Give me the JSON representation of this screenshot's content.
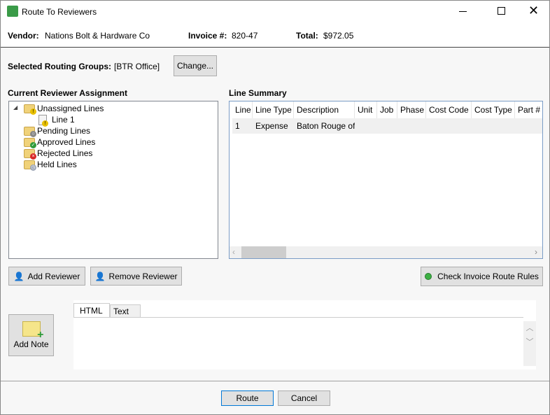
{
  "window": {
    "title": "Route To Reviewers",
    "controls": [
      "minimize",
      "maximize",
      "close"
    ]
  },
  "header": {
    "vendor_label": "Vendor:",
    "vendor": "Nations Bolt & Hardware Co",
    "invoice_label": "Invoice #:",
    "invoice": "820-47",
    "total_label": "Total:",
    "total": "$972.05"
  },
  "routing": {
    "label": "Selected Routing Groups:",
    "value": "[BTR Office]",
    "change_button": "Change..."
  },
  "tree": {
    "title": "Current Reviewer Assignment",
    "items": [
      {
        "label": "Unassigned Lines",
        "icon": "folder-warning-icon"
      },
      {
        "label": "Line 1",
        "icon": "document-warning-icon"
      },
      {
        "label": "Pending Lines",
        "icon": "folder-search-icon"
      },
      {
        "label": "Approved Lines",
        "icon": "folder-check-icon"
      },
      {
        "label": "Rejected Lines",
        "icon": "folder-reject-icon"
      },
      {
        "label": "Held Lines",
        "icon": "folder-clock-icon"
      }
    ]
  },
  "grid": {
    "title": "Line Summary",
    "columns": [
      "Line",
      "Line Type",
      "Description",
      "Unit",
      "Job",
      "Phase",
      "Cost Code",
      "Cost Type",
      "Part #"
    ],
    "rows": [
      [
        "1",
        "Expense",
        "Baton Rouge of",
        "",
        "",
        "",
        "",
        "",
        ""
      ]
    ]
  },
  "buttons": {
    "add_reviewer": "Add Reviewer",
    "remove_reviewer": "Remove Reviewer",
    "check_rules": "Check Invoice Route Rules",
    "add_note": "Add Note",
    "route": "Route",
    "cancel": "Cancel"
  },
  "note_tabs": [
    "HTML",
    "Text"
  ],
  "colors": {
    "status_green": "#3cb043"
  }
}
